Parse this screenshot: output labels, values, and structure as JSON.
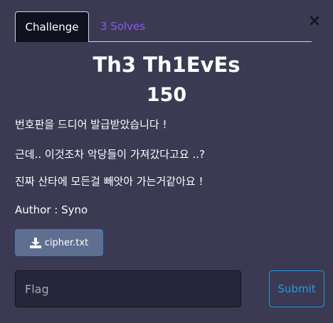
{
  "tabs": {
    "challenge": "Challenge",
    "solves": "3 Solves"
  },
  "close_label": "×",
  "challenge": {
    "title": "Th3 Th1EvEs",
    "points": "150",
    "description": [
      "번호판을 드디어 발급받았습니다 !",
      "근데.. 이것조차 악당들이 가져갔다고요 ..?",
      "진짜 산타에 모든걸 빼앗아 가는거같아요 !"
    ],
    "author": "Author : Syno",
    "file_name": "cipher.txt"
  },
  "flag_form": {
    "placeholder": "Flag",
    "value": "",
    "submit_label": "Submit"
  },
  "colors": {
    "background": "#3b3a52",
    "tab_active_bg": "#101020",
    "solves_link": "#8a5bf0",
    "file_button_bg": "#5f6f8f",
    "submit_accent": "#1f9be4"
  },
  "icons": {
    "file_button": "download-icon",
    "close": "close-icon"
  }
}
